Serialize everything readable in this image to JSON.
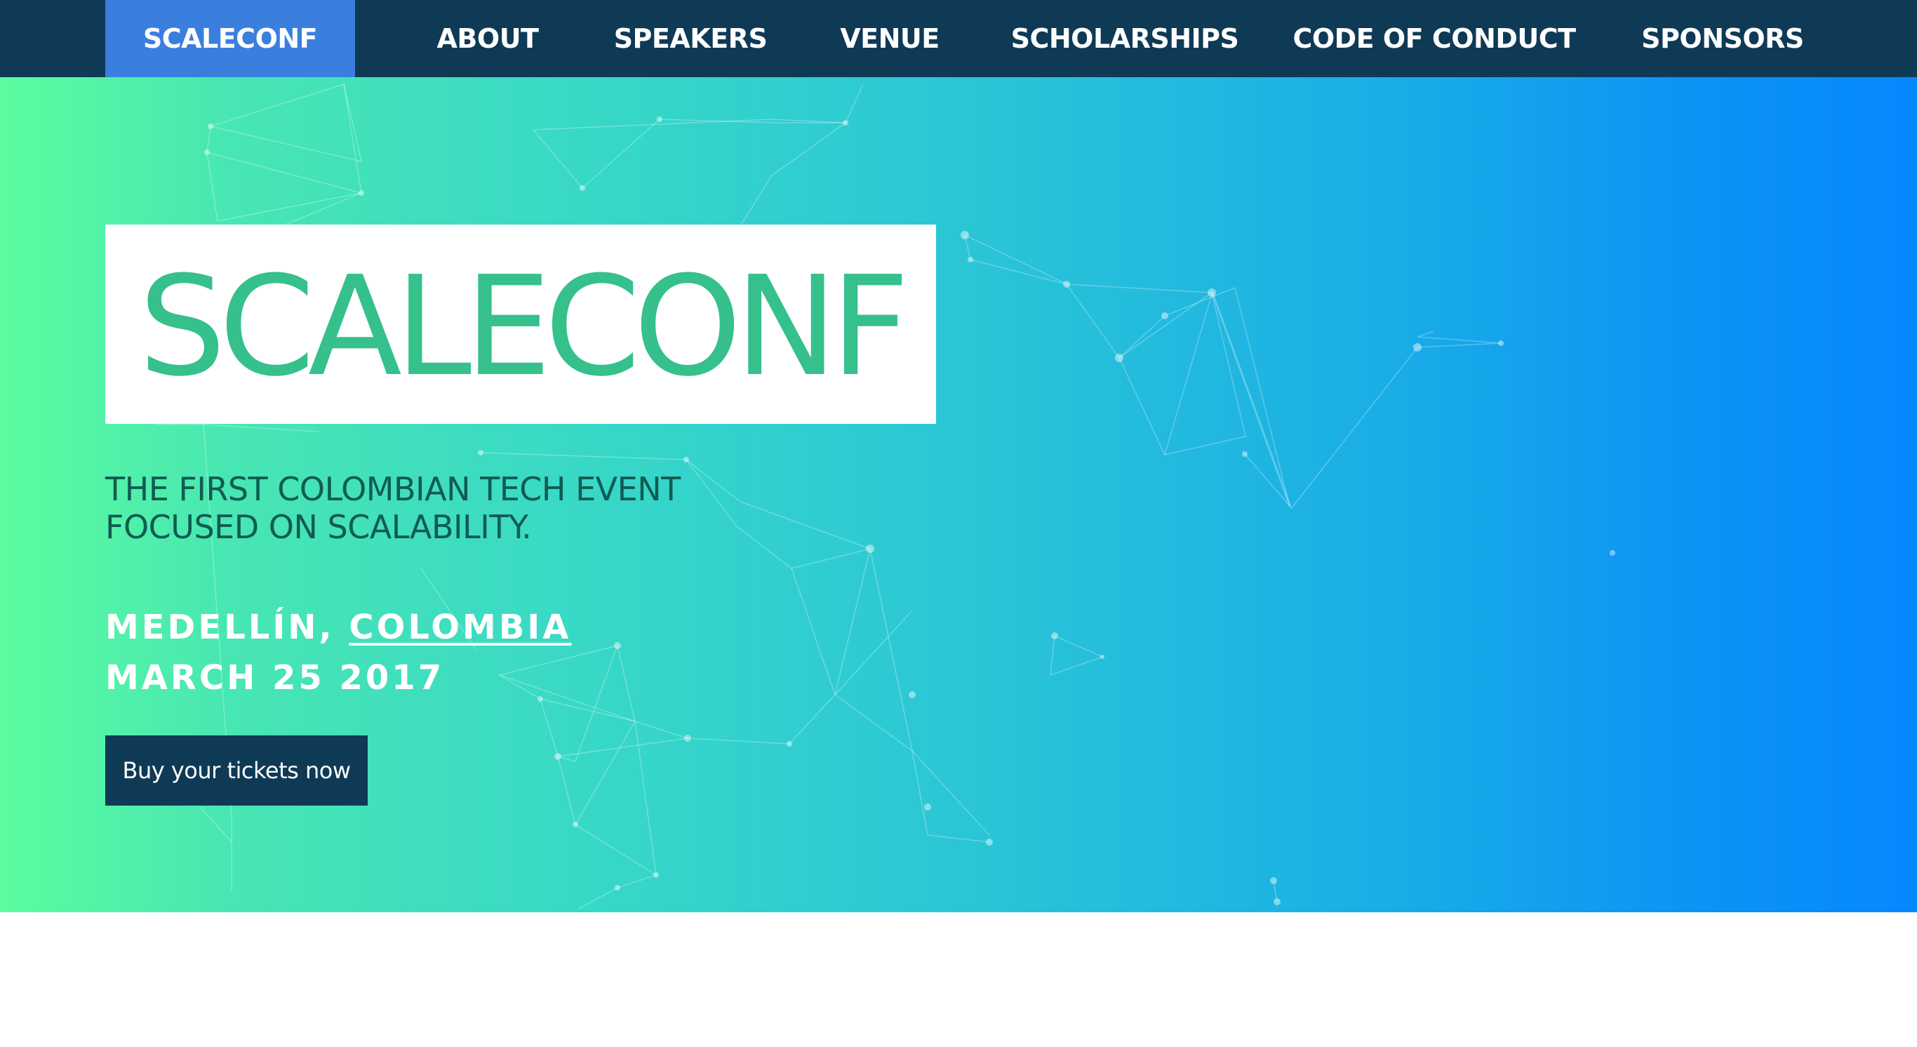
{
  "nav": {
    "items": [
      {
        "label": "SCALECONF",
        "active": true
      },
      {
        "label": "ABOUT",
        "active": false
      },
      {
        "label": "SPEAKERS",
        "active": false
      },
      {
        "label": "VENUE",
        "active": false
      },
      {
        "label": "SCHOLARSHIPS",
        "active": false
      },
      {
        "label": "CODE OF CONDUCT",
        "active": false
      },
      {
        "label": "SPONSORS",
        "active": false
      }
    ]
  },
  "hero": {
    "logo_text": "SCALECONF",
    "tagline_line1": "THE FIRST COLOMBIAN TECH EVENT",
    "tagline_line2": "FOCUSED ON SCALABILITY.",
    "city": "MEDELLÍN, ",
    "country_link": "COLOMBIA",
    "date": "MARCH 25 2017",
    "cta_label": "Buy your tickets now"
  },
  "colors": {
    "nav_bg": "#0f3a56",
    "nav_active": "#3a7fde",
    "gradient_start": "#5bfd9e",
    "gradient_end": "#0588fe",
    "logo_green": "#35c08c",
    "tagline": "#0f5b52",
    "button_bg": "#0f3a56"
  }
}
